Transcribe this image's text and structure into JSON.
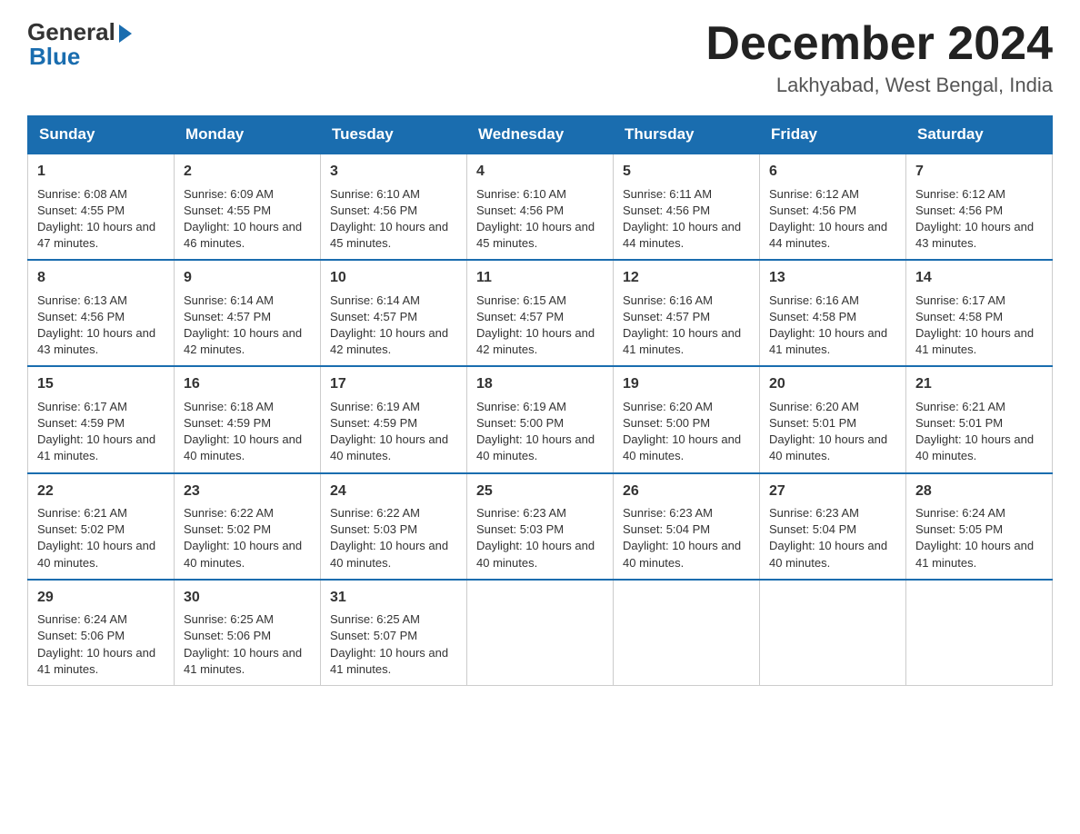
{
  "header": {
    "logo_general": "General",
    "logo_blue": "Blue",
    "month_title": "December 2024",
    "location": "Lakhyabad, West Bengal, India"
  },
  "weekdays": [
    "Sunday",
    "Monday",
    "Tuesday",
    "Wednesday",
    "Thursday",
    "Friday",
    "Saturday"
  ],
  "weeks": [
    [
      {
        "day": "1",
        "sunrise": "6:08 AM",
        "sunset": "4:55 PM",
        "daylight": "10 hours and 47 minutes."
      },
      {
        "day": "2",
        "sunrise": "6:09 AM",
        "sunset": "4:55 PM",
        "daylight": "10 hours and 46 minutes."
      },
      {
        "day": "3",
        "sunrise": "6:10 AM",
        "sunset": "4:56 PM",
        "daylight": "10 hours and 45 minutes."
      },
      {
        "day": "4",
        "sunrise": "6:10 AM",
        "sunset": "4:56 PM",
        "daylight": "10 hours and 45 minutes."
      },
      {
        "day": "5",
        "sunrise": "6:11 AM",
        "sunset": "4:56 PM",
        "daylight": "10 hours and 44 minutes."
      },
      {
        "day": "6",
        "sunrise": "6:12 AM",
        "sunset": "4:56 PM",
        "daylight": "10 hours and 44 minutes."
      },
      {
        "day": "7",
        "sunrise": "6:12 AM",
        "sunset": "4:56 PM",
        "daylight": "10 hours and 43 minutes."
      }
    ],
    [
      {
        "day": "8",
        "sunrise": "6:13 AM",
        "sunset": "4:56 PM",
        "daylight": "10 hours and 43 minutes."
      },
      {
        "day": "9",
        "sunrise": "6:14 AM",
        "sunset": "4:57 PM",
        "daylight": "10 hours and 42 minutes."
      },
      {
        "day": "10",
        "sunrise": "6:14 AM",
        "sunset": "4:57 PM",
        "daylight": "10 hours and 42 minutes."
      },
      {
        "day": "11",
        "sunrise": "6:15 AM",
        "sunset": "4:57 PM",
        "daylight": "10 hours and 42 minutes."
      },
      {
        "day": "12",
        "sunrise": "6:16 AM",
        "sunset": "4:57 PM",
        "daylight": "10 hours and 41 minutes."
      },
      {
        "day": "13",
        "sunrise": "6:16 AM",
        "sunset": "4:58 PM",
        "daylight": "10 hours and 41 minutes."
      },
      {
        "day": "14",
        "sunrise": "6:17 AM",
        "sunset": "4:58 PM",
        "daylight": "10 hours and 41 minutes."
      }
    ],
    [
      {
        "day": "15",
        "sunrise": "6:17 AM",
        "sunset": "4:59 PM",
        "daylight": "10 hours and 41 minutes."
      },
      {
        "day": "16",
        "sunrise": "6:18 AM",
        "sunset": "4:59 PM",
        "daylight": "10 hours and 40 minutes."
      },
      {
        "day": "17",
        "sunrise": "6:19 AM",
        "sunset": "4:59 PM",
        "daylight": "10 hours and 40 minutes."
      },
      {
        "day": "18",
        "sunrise": "6:19 AM",
        "sunset": "5:00 PM",
        "daylight": "10 hours and 40 minutes."
      },
      {
        "day": "19",
        "sunrise": "6:20 AM",
        "sunset": "5:00 PM",
        "daylight": "10 hours and 40 minutes."
      },
      {
        "day": "20",
        "sunrise": "6:20 AM",
        "sunset": "5:01 PM",
        "daylight": "10 hours and 40 minutes."
      },
      {
        "day": "21",
        "sunrise": "6:21 AM",
        "sunset": "5:01 PM",
        "daylight": "10 hours and 40 minutes."
      }
    ],
    [
      {
        "day": "22",
        "sunrise": "6:21 AM",
        "sunset": "5:02 PM",
        "daylight": "10 hours and 40 minutes."
      },
      {
        "day": "23",
        "sunrise": "6:22 AM",
        "sunset": "5:02 PM",
        "daylight": "10 hours and 40 minutes."
      },
      {
        "day": "24",
        "sunrise": "6:22 AM",
        "sunset": "5:03 PM",
        "daylight": "10 hours and 40 minutes."
      },
      {
        "day": "25",
        "sunrise": "6:23 AM",
        "sunset": "5:03 PM",
        "daylight": "10 hours and 40 minutes."
      },
      {
        "day": "26",
        "sunrise": "6:23 AM",
        "sunset": "5:04 PM",
        "daylight": "10 hours and 40 minutes."
      },
      {
        "day": "27",
        "sunrise": "6:23 AM",
        "sunset": "5:04 PM",
        "daylight": "10 hours and 40 minutes."
      },
      {
        "day": "28",
        "sunrise": "6:24 AM",
        "sunset": "5:05 PM",
        "daylight": "10 hours and 41 minutes."
      }
    ],
    [
      {
        "day": "29",
        "sunrise": "6:24 AM",
        "sunset": "5:06 PM",
        "daylight": "10 hours and 41 minutes."
      },
      {
        "day": "30",
        "sunrise": "6:25 AM",
        "sunset": "5:06 PM",
        "daylight": "10 hours and 41 minutes."
      },
      {
        "day": "31",
        "sunrise": "6:25 AM",
        "sunset": "5:07 PM",
        "daylight": "10 hours and 41 minutes."
      },
      null,
      null,
      null,
      null
    ]
  ]
}
